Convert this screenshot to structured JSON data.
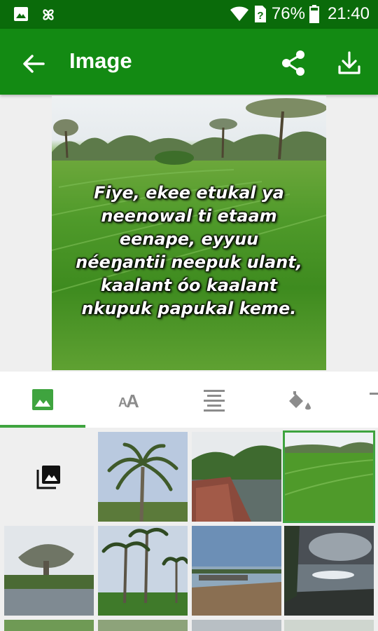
{
  "status_bar": {
    "battery_percent": "76%",
    "time": "21:40"
  },
  "app_bar": {
    "title": "Image"
  },
  "preview": {
    "quote": "Fiye, ekee etukal ya\nneenowal ti etaam\neenape, eyyuu\nnéeŋantii neepuk ulant,\nkaalant óo kaalant\nnkupuk papukal keme."
  },
  "tabs": [
    {
      "icon": "image-icon",
      "selected": true
    },
    {
      "icon": "text-size-icon",
      "selected": false
    },
    {
      "icon": "align-center-icon",
      "selected": false
    },
    {
      "icon": "paint-bucket-icon",
      "selected": false
    }
  ],
  "thumbnails": [
    {
      "subject": "palm tree against sky",
      "selected": false
    },
    {
      "subject": "boat on river",
      "selected": false
    },
    {
      "subject": "rice field",
      "selected": true
    },
    {
      "subject": "baobab by water",
      "selected": false
    },
    {
      "subject": "palm trees",
      "selected": false
    },
    {
      "subject": "river shore",
      "selected": false
    },
    {
      "subject": "sunlit water",
      "selected": false
    }
  ],
  "colors": {
    "status_bar": "#0a6b0a",
    "app_bar": "#138a13",
    "accent": "#3fa43f"
  }
}
